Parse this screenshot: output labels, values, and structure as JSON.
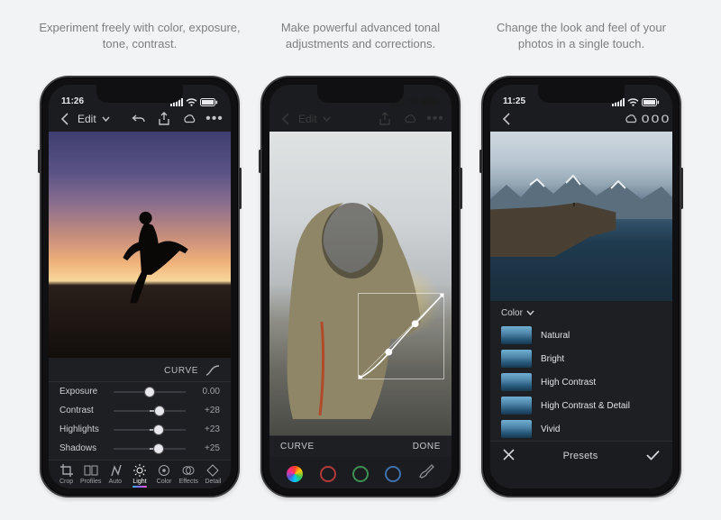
{
  "captions": [
    "Experiment freely with color, exposure, tone, contrast.",
    "Make powerful advanced tonal adjustments and corrections.",
    "Change the look and feel of your photos in a single touch."
  ],
  "status": {
    "time1": "11:26",
    "time3": "11:25"
  },
  "header": {
    "edit_label": "Edit",
    "curve_label": "CURVE",
    "done_label": "DONE",
    "presets_label": "Presets",
    "color_label": "Color"
  },
  "sliders": [
    {
      "label": "Exposure",
      "value": "0.00",
      "pos": 50
    },
    {
      "label": "Contrast",
      "value": "+28",
      "pos": 64
    },
    {
      "label": "Highlights",
      "value": "+23",
      "pos": 62
    },
    {
      "label": "Shadows",
      "value": "+25",
      "pos": 63
    }
  ],
  "tools": [
    {
      "label": "Crop",
      "active": false
    },
    {
      "label": "Profiles",
      "active": false
    },
    {
      "label": "Auto",
      "active": false
    },
    {
      "label": "Light",
      "active": true
    },
    {
      "label": "Color",
      "active": false
    },
    {
      "label": "Effects",
      "active": false
    },
    {
      "label": "Detail",
      "active": false
    }
  ],
  "presets": [
    "Natural",
    "Bright",
    "High Contrast",
    "High Contrast & Detail",
    "Vivid"
  ]
}
